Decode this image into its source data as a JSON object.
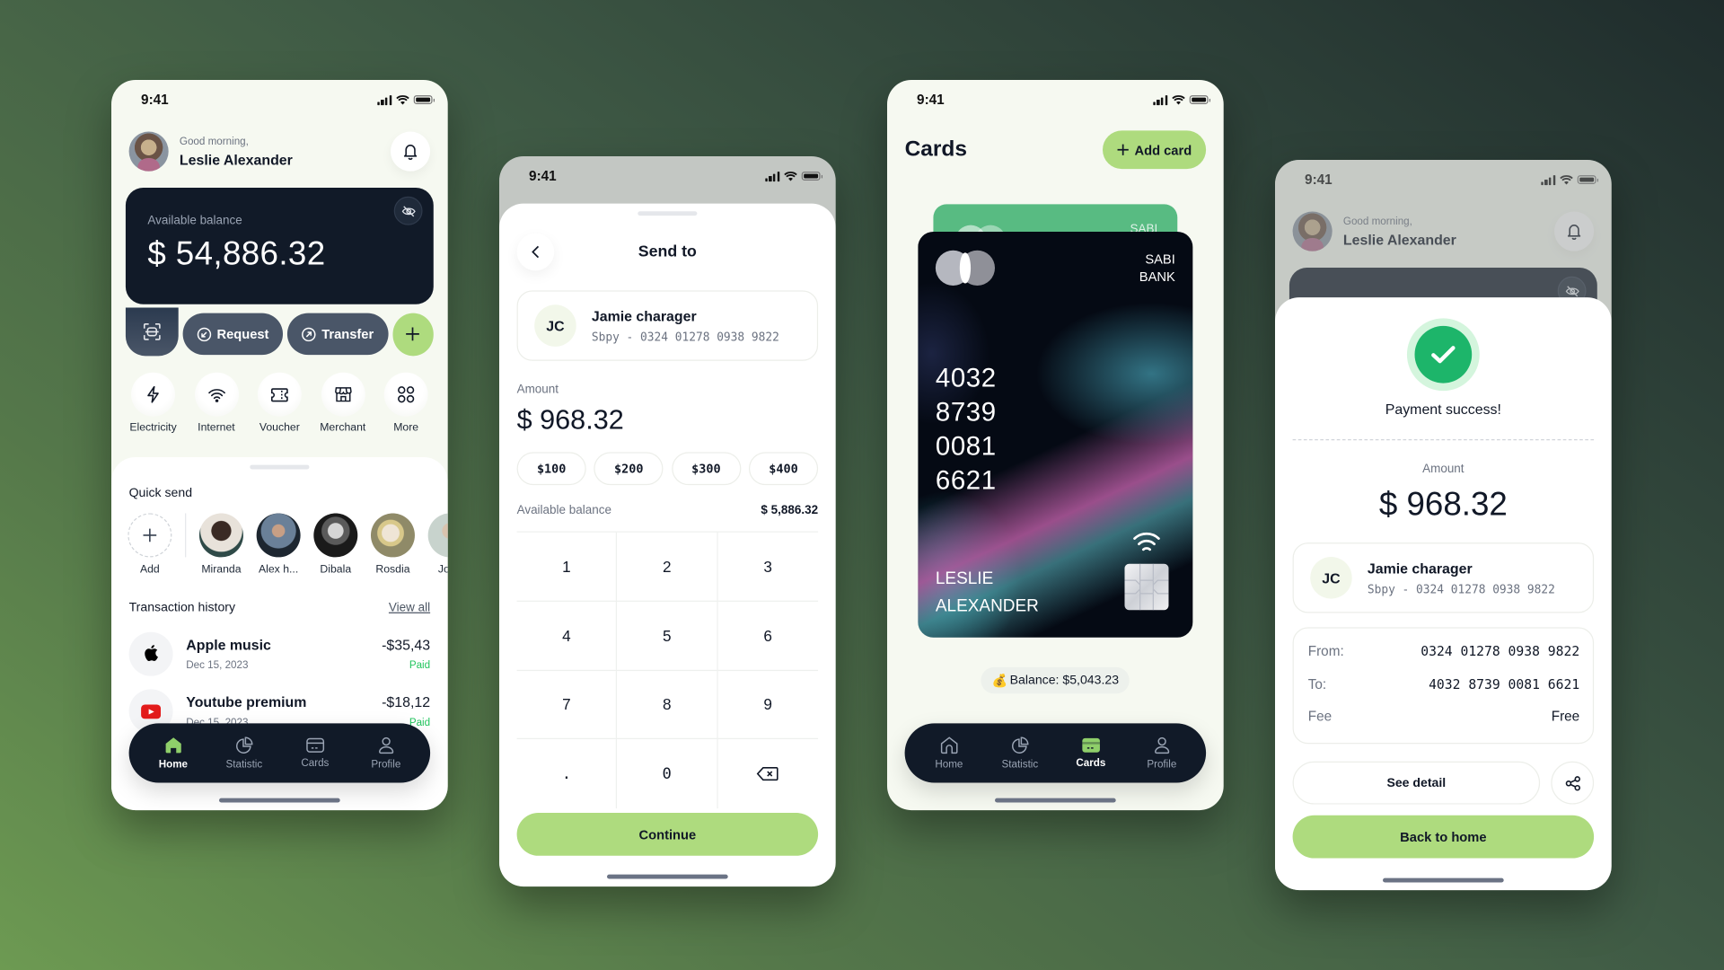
{
  "status_bar": {
    "time": "9:41"
  },
  "home_screen": {
    "greeting": "Good morning,",
    "user_name": "Leslie Alexander",
    "balance_label": "Available balance",
    "balance_value": "$ 54,886.32",
    "actions": {
      "request": "Request",
      "transfer": "Transfer"
    },
    "services": [
      {
        "label": "Electricity",
        "icon": "lightning-icon"
      },
      {
        "label": "Internet",
        "icon": "wifi-icon"
      },
      {
        "label": "Voucher",
        "icon": "ticket-icon"
      },
      {
        "label": "Merchant",
        "icon": "store-icon"
      },
      {
        "label": "More",
        "icon": "grid-icon"
      }
    ],
    "quick_send_title": "Quick send",
    "quick_send": [
      {
        "name": "Add"
      },
      {
        "name": "Miranda",
        "color": "#cfc8c0"
      },
      {
        "name": "Alex h...",
        "color": "#2c3a48"
      },
      {
        "name": "Dibala",
        "color": "#2a2a2a"
      },
      {
        "name": "Rosdia",
        "color": "#b8a982"
      },
      {
        "name": "John",
        "color": "#c9d2cb"
      }
    ],
    "transactions_title": "Transaction history",
    "view_all": "View all",
    "transactions": [
      {
        "name": "Apple music",
        "date": "Dec 15, 2023",
        "amount": "-$35,43",
        "status": "Paid",
        "icon": "apple-icon"
      },
      {
        "name": "Youtube premium",
        "date": "Dec 15, 2023",
        "amount": "-$18,12",
        "status": "Paid",
        "icon": "youtube-icon"
      }
    ]
  },
  "tabbar": {
    "items": [
      {
        "label": "Home"
      },
      {
        "label": "Statistic"
      },
      {
        "label": "Cards"
      },
      {
        "label": "Profile"
      }
    ]
  },
  "send_screen": {
    "title": "Send to",
    "recipient": {
      "initials": "JC",
      "name": "Jamie charager",
      "account": "Sbpy - 0324 01278 0938 9822"
    },
    "amount_label": "Amount",
    "amount_value": "$ 968.32",
    "presets": [
      "$100",
      "$200",
      "$300",
      "$400"
    ],
    "available_label": "Available balance",
    "available_value": "$ 5,886.32",
    "keys": [
      "1",
      "2",
      "3",
      "4",
      "5",
      "6",
      "7",
      "8",
      "9",
      ".",
      "0"
    ],
    "continue_label": "Continue"
  },
  "cards_screen": {
    "title": "Cards",
    "add_card_label": "Add card",
    "back_card_bank": "SABI",
    "card": {
      "bank_line1": "SABI",
      "bank_line2": "BANK",
      "number_groups": [
        "4032",
        "8739",
        "0081",
        "6621"
      ],
      "holder_line1": "LESLIE",
      "holder_line2": "ALEXANDER"
    },
    "balance_badge": "Balance: $5,043.23",
    "balance_emoji": "💰"
  },
  "success_screen": {
    "greeting": "Good morning,",
    "user_name": "Leslie Alexander",
    "title": "Payment success!",
    "amount_label": "Amount",
    "amount_value": "$ 968.32",
    "recipient": {
      "initials": "JC",
      "name": "Jamie charager",
      "account": "Sbpy - 0324 01278 0938 9822"
    },
    "details": [
      {
        "key": "From:",
        "value": "0324 01278 0938 9822"
      },
      {
        "key": "To:",
        "value": "4032 8739 0081 6621"
      },
      {
        "key": "Fee",
        "value": "Free"
      }
    ],
    "see_detail_label": "See detail",
    "back_home_label": "Back to home"
  },
  "colors": {
    "accent_green": "#aedb7e",
    "navy": "#111a28",
    "success_green": "#1db56a",
    "paid_green": "#22c55e"
  }
}
